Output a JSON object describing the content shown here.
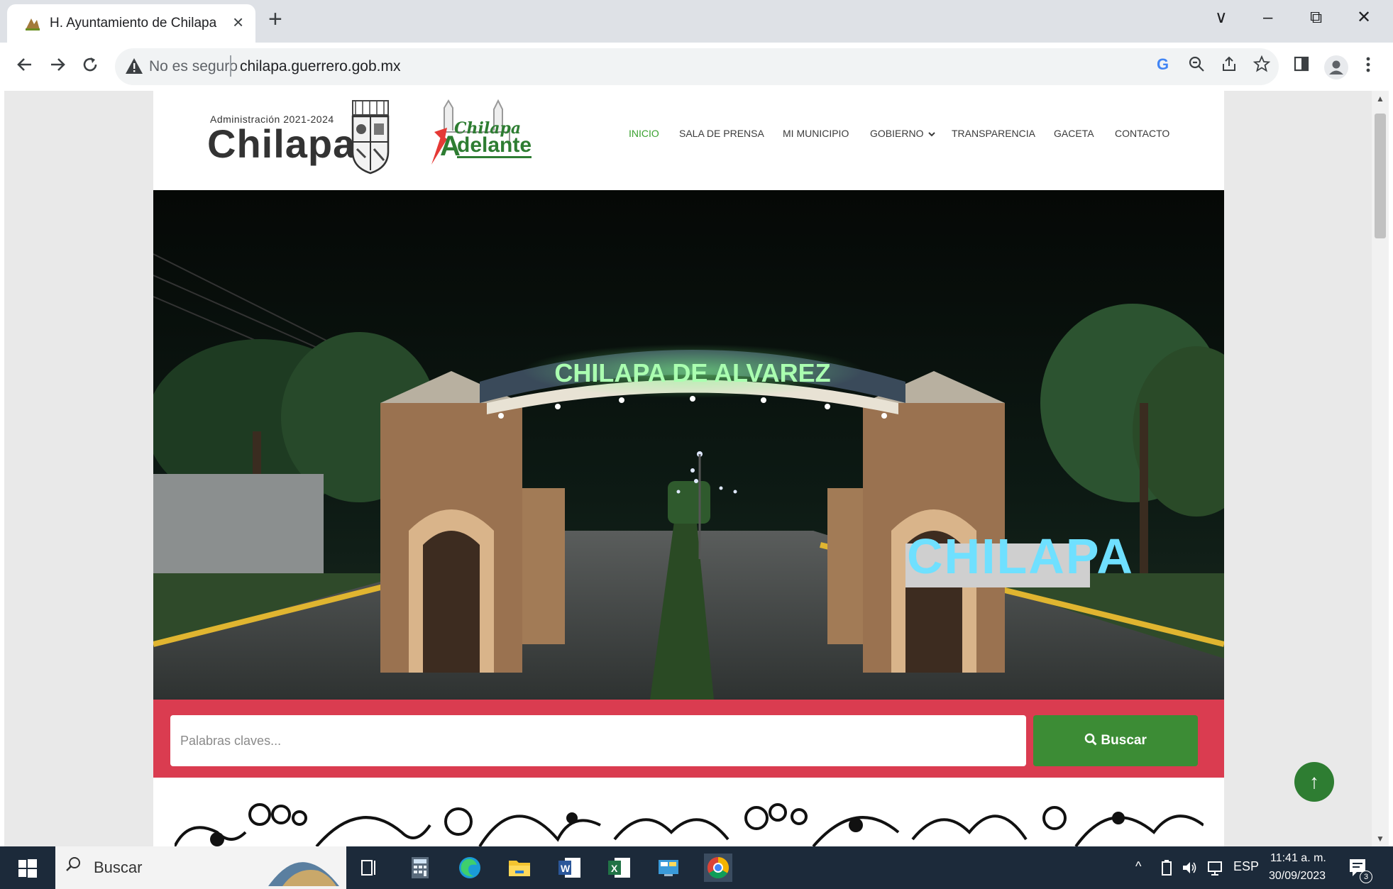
{
  "browser": {
    "tab_title": "H. Ayuntamiento de Chilapa de",
    "tab_close": "×",
    "new_tab": "+",
    "security_label": "No es seguro",
    "url": "chilapa.guerrero.gob.mx",
    "window_controls": [
      "∨",
      "–",
      "⧉",
      "✕"
    ]
  },
  "site": {
    "logo_small": "Administración 2021-2024",
    "logo_big": "Chilapa",
    "logo2_top": "Chilapa",
    "logo2_bottom": "delante",
    "logo2_letter": "A",
    "nav": [
      "INICIO",
      "SALA DE PRENSA",
      "MI MUNICIPIO",
      "GOBIERNO",
      "TRANSPARENCIA",
      "GACETA",
      "CONTACTO"
    ],
    "nav_dropdown_icon": "chevron-down-icon",
    "hero": {
      "arch_text": "CHILAPA DE ALVAREZ",
      "letters_sign": "CHILAPA"
    },
    "search": {
      "placeholder": "Palabras claves...",
      "button": "Buscar"
    },
    "to_top": "↑"
  },
  "taskbar": {
    "search_text": "Buscar",
    "lang": "ESP",
    "time": "11:41 a. m.",
    "date": "30/09/2023",
    "notifications": "3"
  },
  "colors": {
    "nav_active": "#3aa12f",
    "search_bar": "#da3c50",
    "search_button": "#3c8c35",
    "to_top": "#2e7d32"
  }
}
